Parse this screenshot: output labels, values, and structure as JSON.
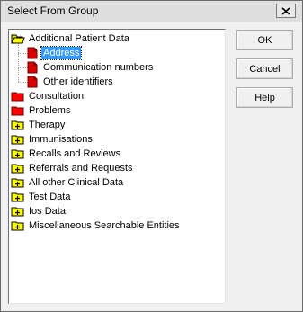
{
  "window": {
    "title": "Select From Group",
    "close_glyph": "close-icon"
  },
  "tree": {
    "items": [
      {
        "label": "Additional Patient Data",
        "icon": "folder-open-icon",
        "level": 0,
        "selected": false
      },
      {
        "label": "Address",
        "icon": "red-document-icon",
        "level": 1,
        "selected": true
      },
      {
        "label": "Communication numbers",
        "icon": "red-document-icon",
        "level": 1,
        "selected": false
      },
      {
        "label": "Other identifiers",
        "icon": "red-document-icon",
        "level": 1,
        "selected": false
      },
      {
        "label": "Consultation",
        "icon": "red-folder-icon",
        "level": 0,
        "selected": false
      },
      {
        "label": "Problems",
        "icon": "red-folder-icon",
        "level": 0,
        "selected": false
      },
      {
        "label": "Therapy",
        "icon": "folder-plus-icon",
        "level": 0,
        "selected": false
      },
      {
        "label": "Immunisations",
        "icon": "folder-plus-icon",
        "level": 0,
        "selected": false
      },
      {
        "label": "Recalls and Reviews",
        "icon": "folder-plus-icon",
        "level": 0,
        "selected": false
      },
      {
        "label": "Referrals and Requests",
        "icon": "folder-plus-icon",
        "level": 0,
        "selected": false
      },
      {
        "label": "All other Clinical Data",
        "icon": "folder-plus-icon",
        "level": 0,
        "selected": false
      },
      {
        "label": "Test Data",
        "icon": "folder-plus-icon",
        "level": 0,
        "selected": false
      },
      {
        "label": "Ios Data",
        "icon": "folder-plus-icon",
        "level": 0,
        "selected": false
      },
      {
        "label": "Miscellaneous Searchable Entities",
        "icon": "folder-plus-icon",
        "level": 0,
        "selected": false
      }
    ]
  },
  "buttons": {
    "ok": "OK",
    "cancel": "Cancel",
    "help": "Help"
  },
  "colors": {
    "selection": "#3399ff",
    "folder_yellow": "#ffff00",
    "folder_red": "#ff0000",
    "document_red": "#dd0000"
  }
}
